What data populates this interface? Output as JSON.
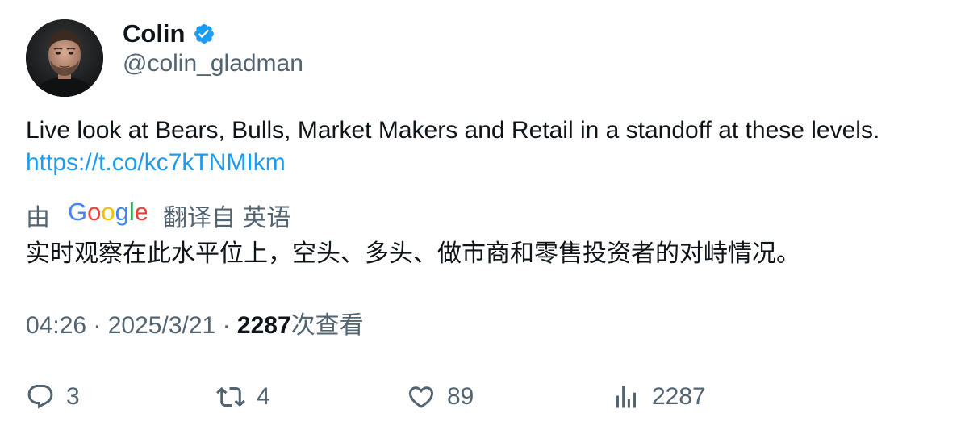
{
  "author": {
    "display_name": "Colin",
    "handle": "@colin_gladman",
    "verified": true,
    "verified_color": "#1d9bf0"
  },
  "tweet": {
    "text": "Live look at Bears, Bulls, Market Makers and Retail in a standoff at these levels.",
    "link": "https://t.co/kc7kTNMIkm",
    "link_color": "#1d9bf0"
  },
  "translation": {
    "prefix": "由",
    "provider": "Google",
    "suffix": "翻译自 英语",
    "text": "实时观察在此水平位上，空头、多头、做市商和零售投资者的对峙情况。"
  },
  "meta": {
    "time": "04:26",
    "separator": "·",
    "date": "2025/3/21",
    "views_count": "2287",
    "views_label": "次查看"
  },
  "actions": {
    "reply": {
      "icon": "reply-icon",
      "count": "3"
    },
    "retweet": {
      "icon": "retweet-icon",
      "count": "4"
    },
    "like": {
      "icon": "heart-icon",
      "count": "89"
    },
    "analytics": {
      "icon": "analytics-icon",
      "count": "2287"
    }
  }
}
